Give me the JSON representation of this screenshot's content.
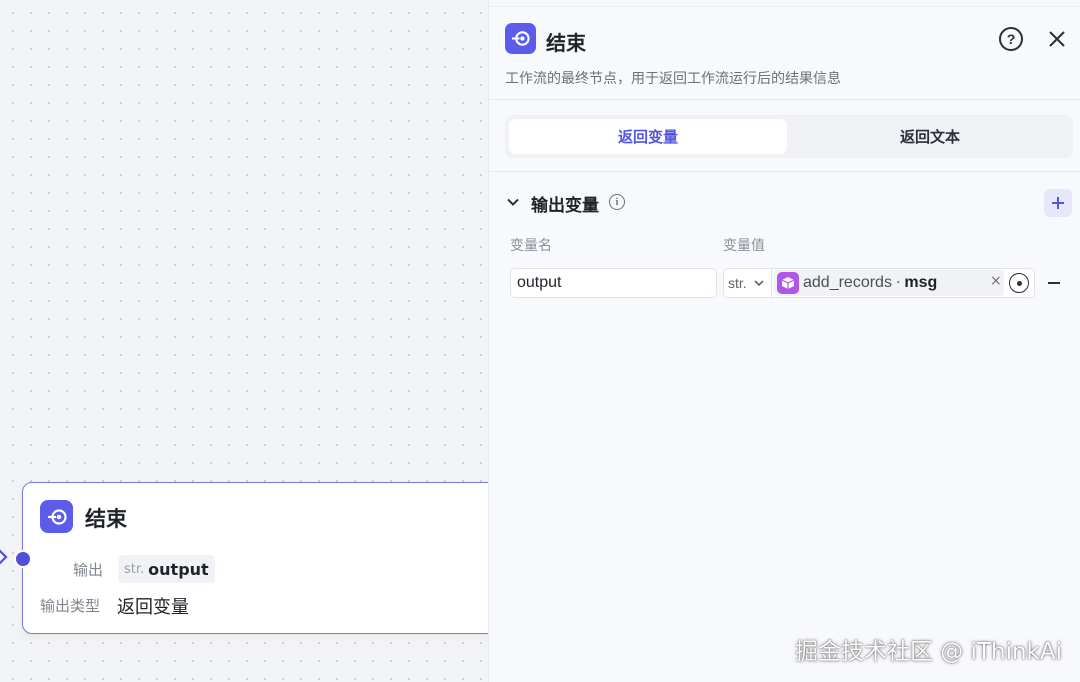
{
  "canvas": {
    "node": {
      "title": "结束",
      "output_label": "输出",
      "output_type": "str.",
      "output_name": "output",
      "type_label": "输出类型",
      "type_value": "返回变量"
    }
  },
  "panel": {
    "title": "结束",
    "description": "工作流的最终节点，用于返回工作流运行后的结果信息",
    "tabs": [
      {
        "label": "返回变量",
        "active": true
      },
      {
        "label": "返回文本",
        "active": false
      }
    ],
    "section": {
      "title": "输出变量",
      "col_name": "变量名",
      "col_value": "变量值"
    },
    "row": {
      "name": "output",
      "type": "str.",
      "ref_node": "add_records",
      "ref_separator": "·",
      "ref_var": "msg",
      "clear": "×"
    }
  },
  "watermark": "掘金技术社区 @ iThinkAi",
  "colors": {
    "accent": "#5b5ce8",
    "active_tab_text": "#5256e0",
    "ref_icon": "#b056e8",
    "node_border": "#7b78e6"
  },
  "icons": [
    "end-node-icon",
    "help-icon",
    "close-icon",
    "chevron-down-icon",
    "info-icon",
    "add-icon",
    "cube-icon",
    "target-icon",
    "remove-icon"
  ]
}
